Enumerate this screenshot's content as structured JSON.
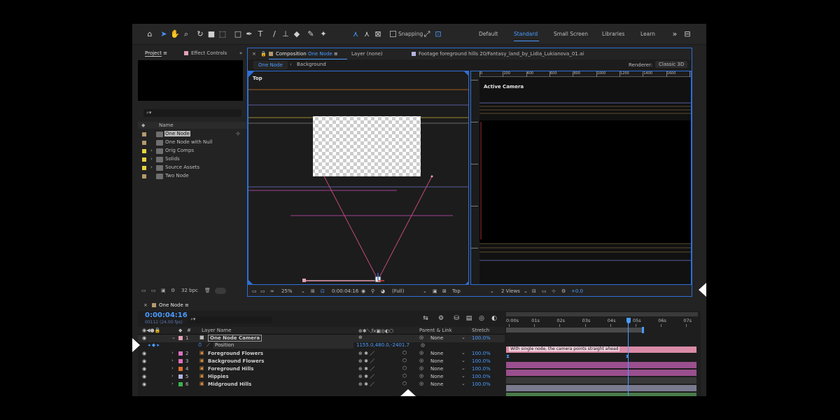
{
  "toolbar": {
    "snapping_label": "Snapping",
    "workspaces": [
      "Default",
      "Standard",
      "Small Screen",
      "Libraries",
      "Learn"
    ],
    "active_workspace": "Standard"
  },
  "project": {
    "tab_label": "Project",
    "effect_controls_label": "Effect Controls",
    "column_name": "Name",
    "items": [
      {
        "name": "One Node",
        "color": "#b49a6e",
        "type": "comp",
        "selected": true
      },
      {
        "name": "One Node with Null",
        "color": "#b49a6e",
        "type": "comp"
      },
      {
        "name": "Orig Comps",
        "color": "#e6d342",
        "type": "folder"
      },
      {
        "name": "Solids",
        "color": "#e6d342",
        "type": "folder"
      },
      {
        "name": "Source Assets",
        "color": "#e6d342",
        "type": "folder"
      },
      {
        "name": "Two Node",
        "color": "#b49a6e",
        "type": "comp"
      }
    ],
    "bpc": "32 bpc"
  },
  "viewer": {
    "comp_prefix": "Composition",
    "comp_name": "One Node",
    "layer_label": "Layer (none)",
    "footage_label": "Footage foreground hills 20/Fantasy_land_by_Lidia_Lukianova_01.ai",
    "subtab_active": "One Node",
    "subtab_other": "Background",
    "renderer_label": "Renderer:",
    "renderer_value": "Classic 3D",
    "left_view_label": "Top",
    "right_view_label": "Active Camera",
    "ruler_ticks": [
      "0",
      "100",
      "200",
      "300",
      "400",
      "500",
      "600",
      "700",
      "800",
      "900",
      "1000",
      "1100",
      "1200",
      "1300",
      "1400",
      "1500",
      "1600",
      "1700",
      "1800"
    ],
    "footer": {
      "zoom": "25%",
      "time": "0:00:04:16",
      "resolution": "(Full)",
      "view": "Top",
      "views": "2 Views",
      "exposure": "+0.0"
    }
  },
  "timeline": {
    "comp_tab": "One Node",
    "current_time": "0:00:04:16",
    "frame_info": "00112 (24.00 fps)",
    "col_layer_name": "Layer Name",
    "col_parent": "Parent & Link",
    "col_stretch": "Stretch",
    "ruler": [
      "0:00s",
      "01s",
      "02s",
      "03s",
      "04s",
      "05s",
      "06s",
      "07s"
    ],
    "playhead_fraction": 0.64,
    "layers": [
      {
        "num": "1",
        "name": "One Node Camera",
        "color": "#e6a0b4",
        "parent": "None",
        "stretch": "100.0%",
        "bar_color": "#d98aa6",
        "type": "camera"
      },
      {
        "num": "2",
        "name": "Foreground Flowers",
        "color": "#e070c0",
        "parent": "None",
        "stretch": "100.0%",
        "bar_color": "#9a4f8e"
      },
      {
        "num": "3",
        "name": "Background Flowers",
        "color": "#e070c0",
        "parent": "None",
        "stretch": "100.0%",
        "bar_color": "#9a4f8e"
      },
      {
        "num": "4",
        "name": "Foreground Hills",
        "color": "#e07030",
        "parent": "None",
        "stretch": "100.0%",
        "bar_color": "#3a3a3a"
      },
      {
        "num": "5",
        "name": "Hippies",
        "color": "#b4b4e0",
        "parent": "None",
        "stretch": "100.0%",
        "bar_color": "#7a7a8e"
      },
      {
        "num": "6",
        "name": "Midground Hills",
        "color": "#3cb450",
        "parent": "None",
        "stretch": "100.0%",
        "bar_color": "#4a7a4a"
      }
    ],
    "position_label": "Position",
    "position_value": "1155.0,480.0,-2401.7",
    "marker_comment": "With single node, the camera points straight ahead"
  }
}
